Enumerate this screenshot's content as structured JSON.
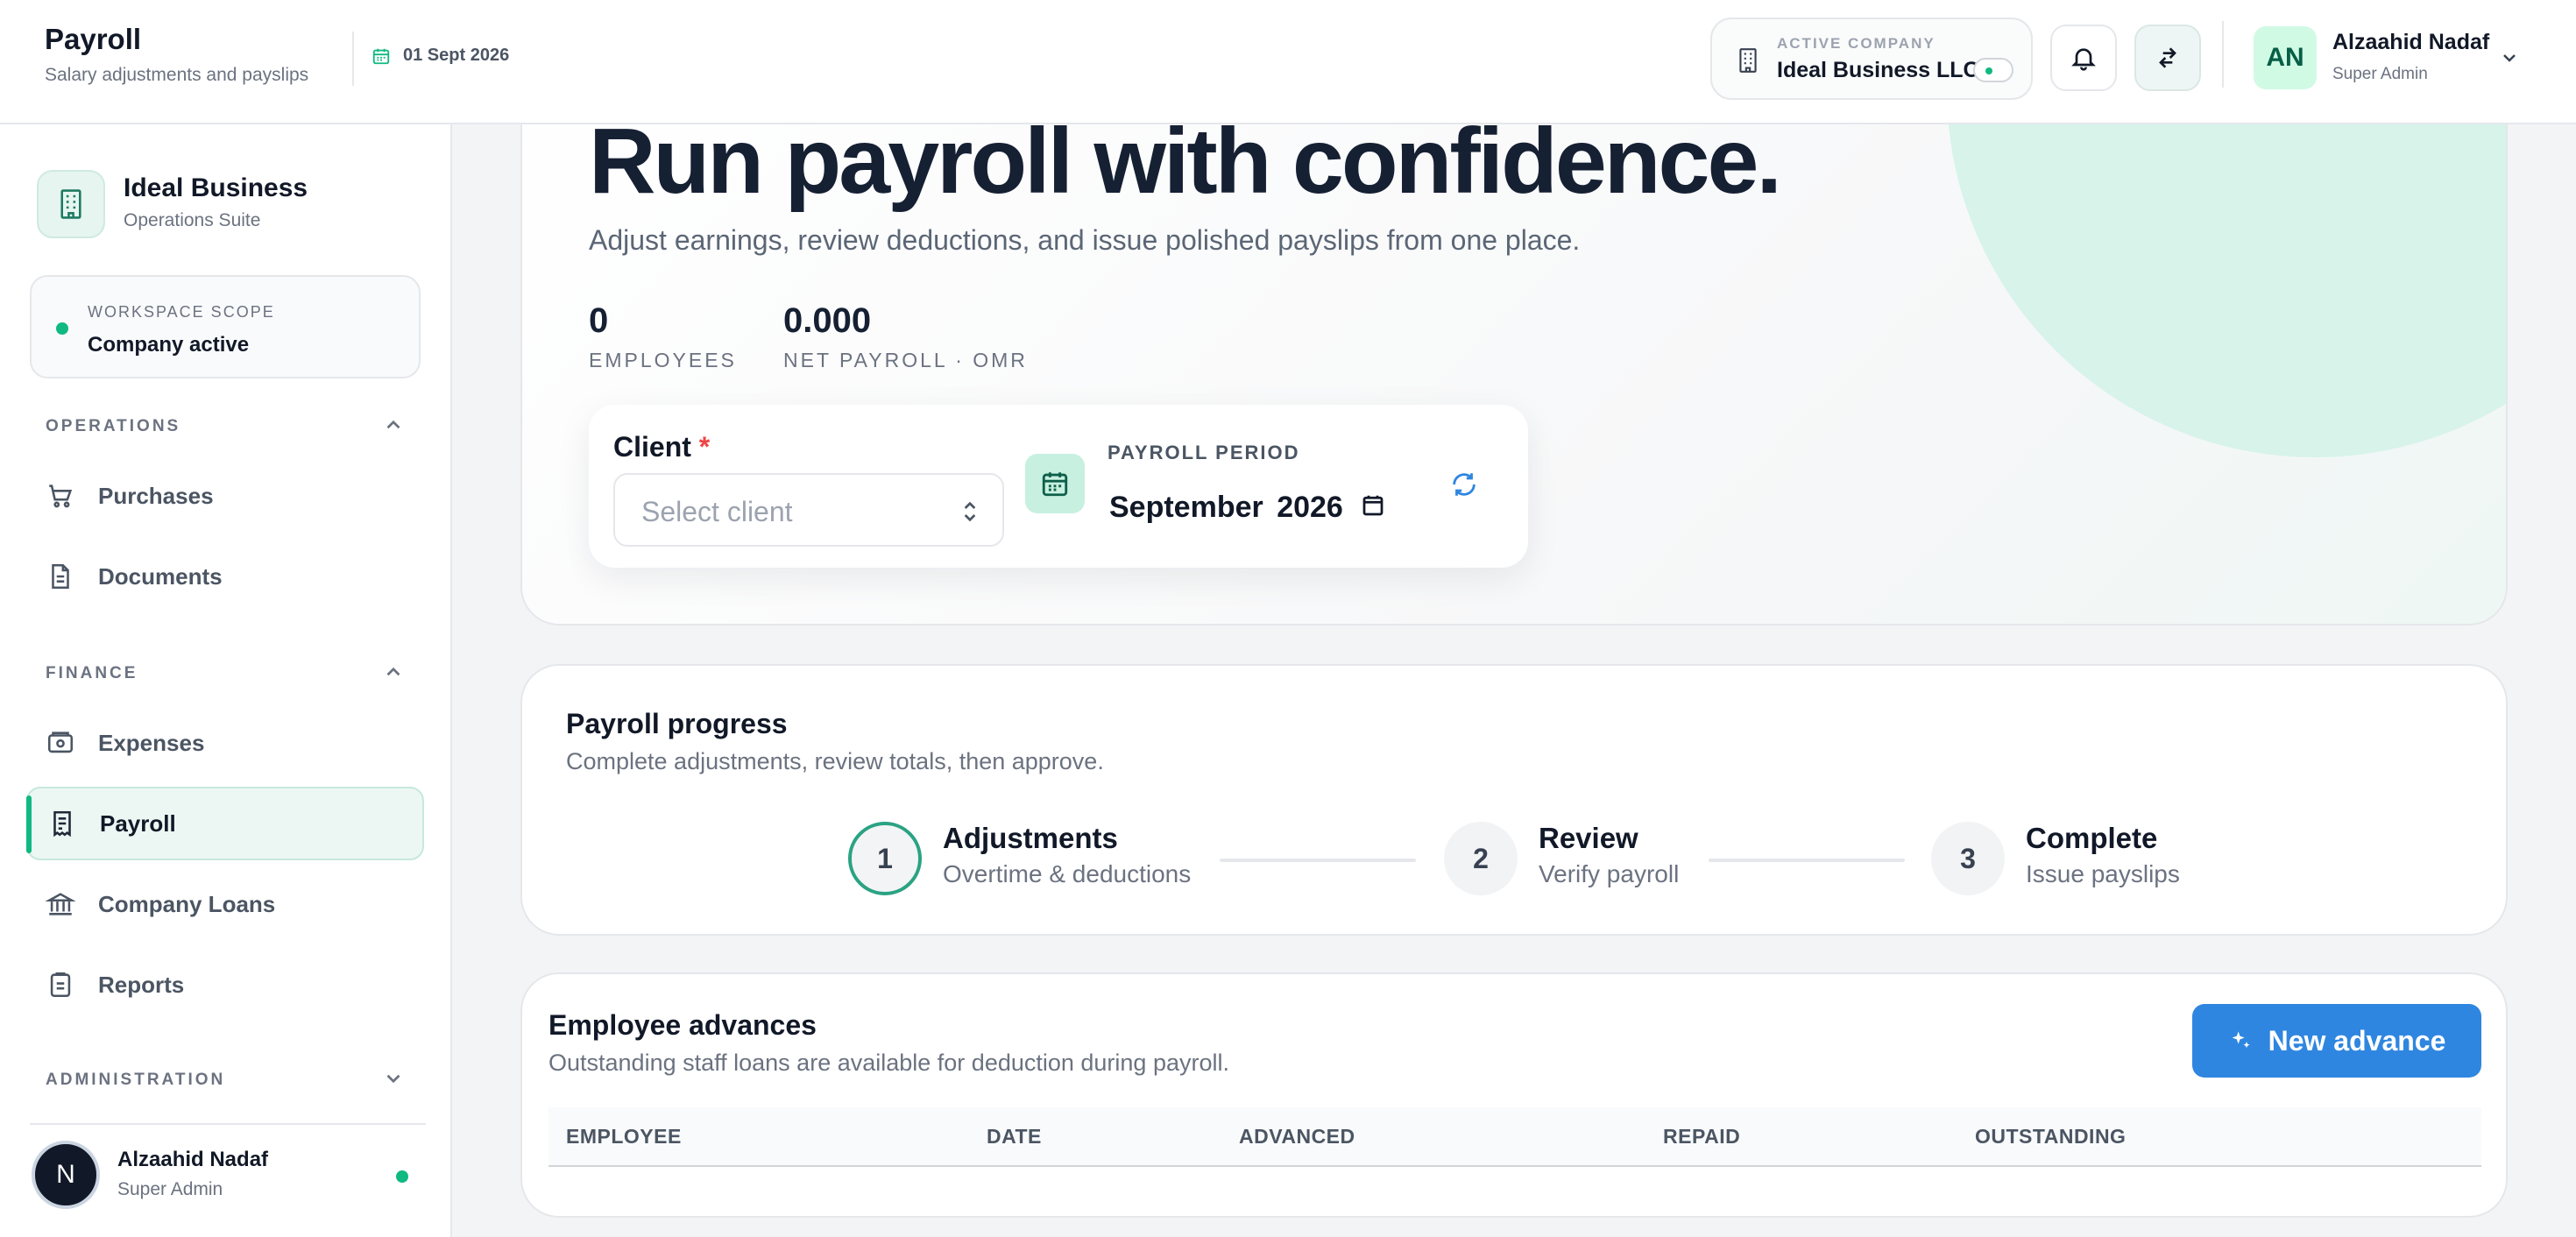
{
  "header": {
    "title": "Payroll",
    "subtitle": "Salary adjustments and payslips",
    "date": "01 Sept 2026",
    "active_company_label": "ACTIVE COMPANY",
    "active_company_name": "Ideal Business LLC",
    "user": {
      "initials": "AN",
      "name": "Alzaahid Nadaf",
      "role": "Super Admin"
    }
  },
  "sidebar": {
    "brand": {
      "name": "Ideal Business",
      "subtitle": "Operations Suite"
    },
    "scope": {
      "label": "WORKSPACE SCOPE",
      "value": "Company active"
    },
    "sections": [
      {
        "label": "OPERATIONS",
        "items": [
          {
            "label": "Purchases",
            "icon": "cart-icon"
          },
          {
            "label": "Documents",
            "icon": "document-icon"
          }
        ]
      },
      {
        "label": "FINANCE",
        "items": [
          {
            "label": "Expenses",
            "icon": "wallet-icon"
          },
          {
            "label": "Payroll",
            "icon": "receipt-icon",
            "active": true
          },
          {
            "label": "Company Loans",
            "icon": "bank-icon"
          },
          {
            "label": "Reports",
            "icon": "clipboard-icon"
          }
        ]
      },
      {
        "label": "ADMINISTRATION",
        "items": []
      }
    ],
    "user": {
      "initial": "N",
      "name": "Alzaahid Nadaf",
      "role": "Super Admin"
    }
  },
  "hero": {
    "title": "Run payroll with confidence.",
    "subtitle": "Adjust earnings, review deductions, and issue polished payslips from one place.",
    "stats": [
      {
        "value": "0",
        "label": "EMPLOYEES"
      },
      {
        "value": "0.000",
        "label": "NET PAYROLL · OMR"
      }
    ],
    "client": {
      "label": "Client",
      "required_mark": "*",
      "placeholder": "Select client"
    },
    "period": {
      "label": "PAYROLL PERIOD",
      "month": "September",
      "year": "2026"
    }
  },
  "progress": {
    "title": "Payroll progress",
    "subtitle": "Complete adjustments, review totals, then approve.",
    "steps": [
      {
        "number": "1",
        "title": "Adjustments",
        "subtitle": "Overtime & deductions",
        "active": true
      },
      {
        "number": "2",
        "title": "Review",
        "subtitle": "Verify payroll"
      },
      {
        "number": "3",
        "title": "Complete",
        "subtitle": "Issue payslips"
      }
    ]
  },
  "advances": {
    "title": "Employee advances",
    "subtitle": "Outstanding staff loans are available for deduction during payroll.",
    "new_button": "New advance",
    "columns": [
      "EMPLOYEE",
      "DATE",
      "ADVANCED",
      "REPAID",
      "OUTSTANDING"
    ],
    "rows": []
  },
  "colors": {
    "accent": "#10b981",
    "primary_button": "#2f86e0",
    "required": "#ef4444"
  }
}
